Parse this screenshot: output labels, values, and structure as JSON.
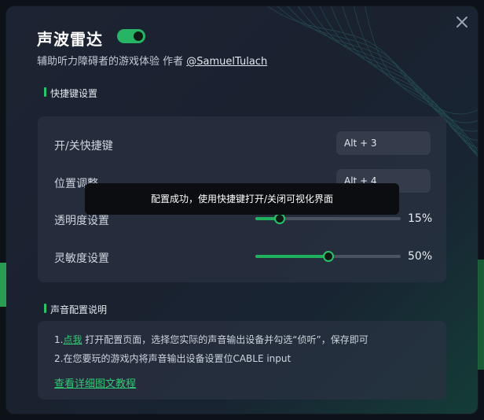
{
  "dialog": {
    "title": "声波雷达",
    "enabled": true,
    "subtitle_prefix": "辅助听力障碍者的游戏体验 作者",
    "author_link": "@SamuelTulach"
  },
  "hotkeys_section": {
    "heading": "快捷键设置",
    "rows": [
      {
        "label": "开/关快捷键",
        "value": "Alt + 3"
      },
      {
        "label": "位置调整",
        "value": "Alt + 4"
      }
    ],
    "sliders": [
      {
        "label": "透明度设置",
        "value_text": "15%",
        "fraction": 0.17
      },
      {
        "label": "灵敏度设置",
        "value_text": "50%",
        "fraction": 0.5
      }
    ]
  },
  "toast": {
    "message": "配置成功，使用快捷键打开/关闭可视化界面"
  },
  "audio_section": {
    "heading": "声音配置说明",
    "line1_number": "1.",
    "line1_link": "点我",
    "line1_rest": " 打开配置页面，选择您实际的声音输出设备并勾选“侦听”，保存即可",
    "line2": "2.在您要玩的游戏内将声音输出设备设置位CABLE input",
    "tutorial_link": "查看详细图文教程"
  },
  "colors": {
    "accent": "#2bc26d",
    "background": "#1c2433",
    "card": "#2a3242",
    "toast": "#0b0d11"
  }
}
